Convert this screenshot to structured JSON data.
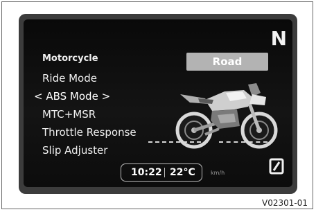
{
  "gear": "N",
  "menu": {
    "header": "Motorcycle",
    "items": [
      {
        "label": "Ride Mode"
      },
      {
        "label": "ABS Mode",
        "selected": true
      },
      {
        "label": "MTC+MSR"
      },
      {
        "label": "Throttle Response"
      },
      {
        "label": "Slip Adjuster"
      }
    ],
    "selected_left_arrow": "<",
    "selected_right_arrow": ">"
  },
  "selected_value": "Road",
  "status": {
    "time": "10:22",
    "temperature": "22°C",
    "speed_unit": "km/h"
  },
  "figure_code": "V02301-01",
  "colors": {
    "screen_background": "#0f0f0f",
    "bezel": "#3c3c3c",
    "value_box": "#b3b3b3",
    "text": "#f0f0f0"
  },
  "icons": [
    "motorcycle-illustration",
    "lock-badge-icon"
  ]
}
